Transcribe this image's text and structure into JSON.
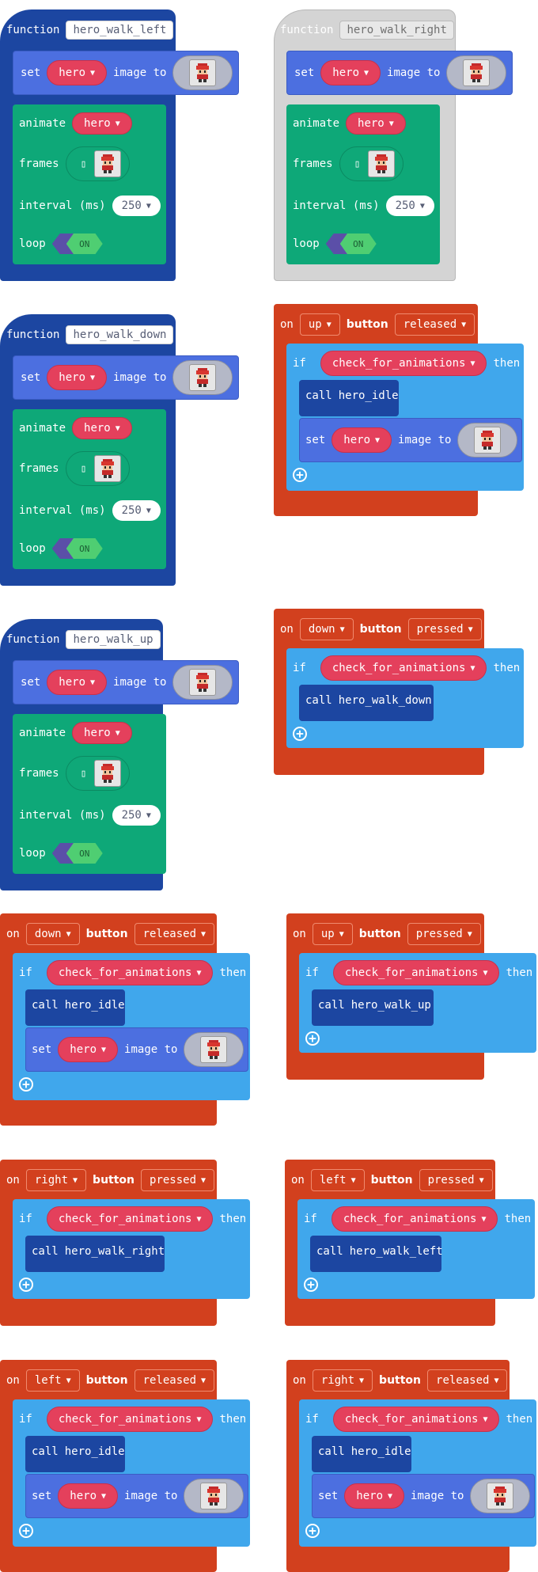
{
  "kw": {
    "function": "function",
    "set": "set",
    "image_to": "image to",
    "animate": "animate",
    "frames": "frames",
    "interval": "interval (ms)",
    "loop": "loop",
    "on": "on",
    "button": "button",
    "if": "if",
    "then": "then",
    "call": "call"
  },
  "sprite_var": "hero",
  "interval_value": "250",
  "loop_value": "ON",
  "condition_fn": "check_for_animations",
  "functions": [
    {
      "name": "hero_walk_left",
      "disabled": false
    },
    {
      "name": "hero_walk_right",
      "disabled": true
    },
    {
      "name": "hero_walk_down",
      "disabled": false
    },
    {
      "name": "hero_walk_up",
      "disabled": false
    }
  ],
  "events": [
    {
      "btn": "up",
      "event": "released",
      "call": "hero_idle"
    },
    {
      "btn": "down",
      "event": "pressed",
      "call": "hero_walk_down"
    },
    {
      "btn": "down",
      "event": "released",
      "call": "hero_idle"
    },
    {
      "btn": "up",
      "event": "pressed",
      "call": "hero_walk_up"
    },
    {
      "btn": "right",
      "event": "pressed",
      "call": "hero_walk_right"
    },
    {
      "btn": "left",
      "event": "pressed",
      "call": "hero_walk_left"
    },
    {
      "btn": "left",
      "event": "released",
      "call": "hero_idle"
    },
    {
      "btn": "right",
      "event": "released",
      "call": "hero_idle"
    }
  ],
  "icons": {
    "add": "plus-circle-icon",
    "dropdown": "caret-down-icon",
    "sprite": "hero-sprite-icon",
    "frames_placeholder": "frames-box-icon"
  },
  "colors": {
    "function": "#1c46a1",
    "function_hat": "#1c46a1",
    "set_block": "#4c6fe0",
    "animation": "#0ea878",
    "event": "#d2401e",
    "if_block": "#40a7ec",
    "call": "#1c46a1",
    "pill_pink": "#e4405c",
    "disabled": "#d0d0d0",
    "toggle_on": "#4fce72",
    "toggle_off": "#5b4fa8"
  }
}
